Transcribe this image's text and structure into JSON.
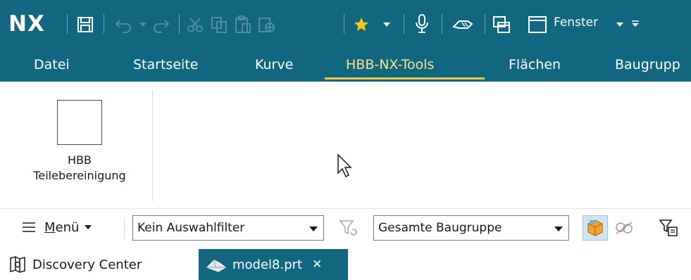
{
  "app": {
    "logo": "NX",
    "window_menu_label": "Fenster"
  },
  "colors": {
    "bar": "#13667f",
    "active_tab_text": "#ffe18a",
    "active_underline": "#f2c54b",
    "favorite_star": "#f5c518"
  },
  "quick_access": {
    "icons": [
      "save-icon",
      "undo-icon",
      "undo-dropdown-icon",
      "redo-icon",
      "cut-icon",
      "copy-icon",
      "paste-icon",
      "paste-special-icon",
      "favorite-star-icon",
      "favorite-dropdown-icon",
      "microphone-icon",
      "touch-mode-icon",
      "window-switch-icon",
      "window-icon",
      "window-dropdown-icon",
      "customize-icon"
    ]
  },
  "ribbon_tabs": [
    {
      "label": "Datei",
      "active": false
    },
    {
      "label": "Startseite",
      "active": false
    },
    {
      "label": "Kurve",
      "active": false
    },
    {
      "label": "HBB-NX-Tools",
      "active": true
    },
    {
      "label": "Flächen",
      "active": false
    },
    {
      "label": "Baugrupp",
      "active": false
    }
  ],
  "ribbon": {
    "command": {
      "label_line1": "HBB",
      "label_line2": "Teilebereinigung"
    }
  },
  "selection_bar": {
    "menu_label_underlined": "M",
    "menu_label_rest": "enü",
    "filter": {
      "value": "Kein Auswahlfilter"
    },
    "scope": {
      "value": "Gesamte Baugruppe"
    }
  },
  "document_tabs": [
    {
      "label": "Discovery Center",
      "active": false
    },
    {
      "label": "model8.prt",
      "active": true,
      "close": "✕"
    }
  ]
}
